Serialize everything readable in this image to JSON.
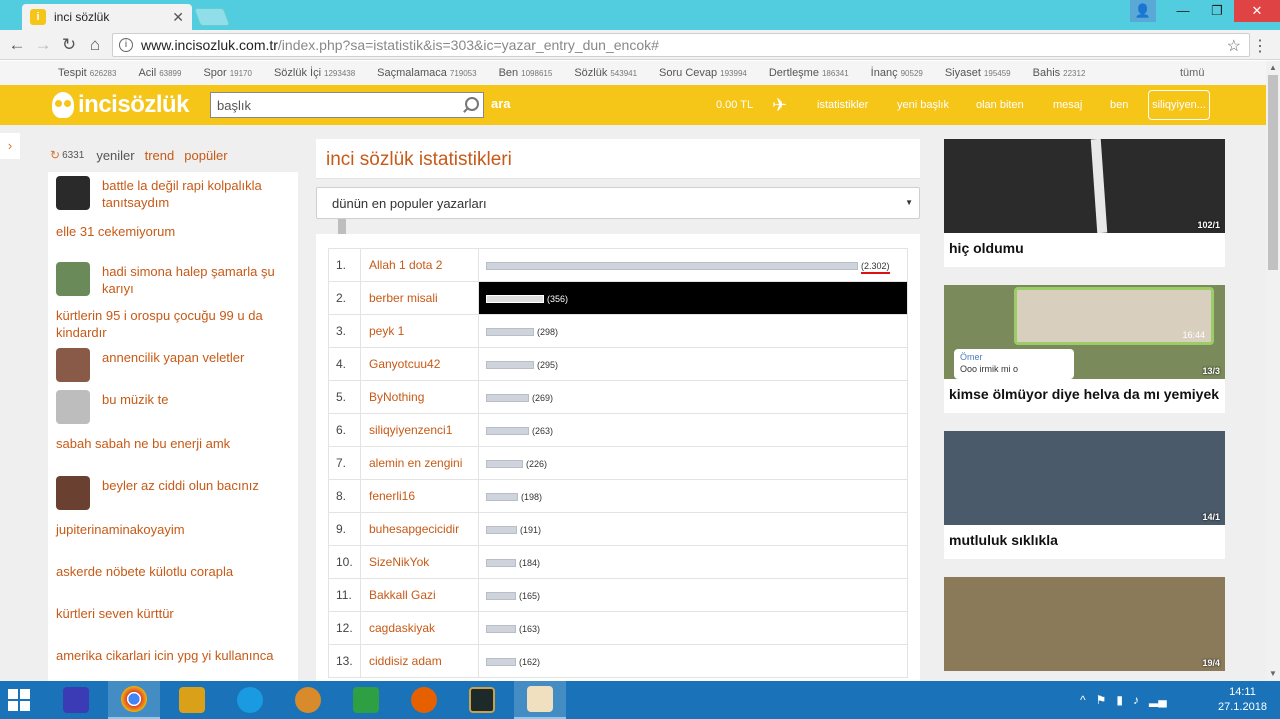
{
  "browser": {
    "tab_title": "inci sözlük",
    "url_host": "www.incisozluk.com.tr",
    "url_path": "/index.php?sa=istatistik&is=303&ic=yazar_entry_dun_encok#"
  },
  "categories": [
    {
      "name": "Tespit",
      "count": "626283"
    },
    {
      "name": "Acil",
      "count": "63899"
    },
    {
      "name": "Spor",
      "count": "19170"
    },
    {
      "name": "Sözlük İçi",
      "count": "1293438"
    },
    {
      "name": "Saçmalamaca",
      "count": "719053"
    },
    {
      "name": "Ben",
      "count": "1098615"
    },
    {
      "name": "Sözlük",
      "count": "543941"
    },
    {
      "name": "Soru Cevap",
      "count": "193994"
    },
    {
      "name": "Dertleşme",
      "count": "186341"
    },
    {
      "name": "İnanç",
      "count": "90529"
    },
    {
      "name": "Siyaset",
      "count": "195459"
    },
    {
      "name": "Bahis",
      "count": "22312"
    }
  ],
  "categories_all": "tümü",
  "header": {
    "logo": "incisözlük",
    "search_placeholder": "başlık",
    "search_button": "ara",
    "balance": "0.00 TL",
    "links": [
      "istatistikler",
      "yeni başlık",
      "olan biten",
      "mesaj",
      "ben"
    ],
    "user": "siliqyiyen..."
  },
  "left": {
    "refresh_count": "6331",
    "tabs": [
      "yeniler",
      "trend",
      "popüler"
    ],
    "items": [
      {
        "title": "battle la değil rapi kolpalıkla tanıtsaydım",
        "thumb": "#2a2a2a"
      },
      {
        "title": "elle 31 cekemiyorum",
        "thumb": null
      },
      {
        "title": "hadi simona halep şamarla şu karıyı",
        "thumb": "#6b8a5a"
      },
      {
        "title": "kürtlerin 95 i orospu çocuğu 99 u da kindardır",
        "thumb": null
      },
      {
        "title": "annencilik yapan veletler",
        "thumb": "#8a5a48"
      },
      {
        "title": "bu müzik te",
        "thumb": "#bdbdbd"
      },
      {
        "title": "sabah sabah ne bu enerji amk",
        "thumb": null
      },
      {
        "title": "beyler az ciddi olun bacınız",
        "thumb": "#6a4030"
      },
      {
        "title": "jupiterinaminakoyayim",
        "thumb": null
      },
      {
        "title": "askerde nöbete külotlu corapla",
        "thumb": null
      },
      {
        "title": "kürtleri seven kürttür",
        "thumb": null
      },
      {
        "title": "amerika cikarlari icin ypg yi kullanınca",
        "thumb": null
      }
    ]
  },
  "center": {
    "title": "inci sözlük istatistikleri",
    "select_value": "dünün en populer yazarları",
    "rows": [
      {
        "rank": "1.",
        "author": "Allah 1 dota 2",
        "count": "(2.302)"
      },
      {
        "rank": "2.",
        "author": "berber misali",
        "count": "(356)"
      },
      {
        "rank": "3.",
        "author": "peyk 1",
        "count": "(298)"
      },
      {
        "rank": "4.",
        "author": "Ganyotcuu42",
        "count": "(295)"
      },
      {
        "rank": "5.",
        "author": "ByNothing",
        "count": "(269)"
      },
      {
        "rank": "6.",
        "author": "siliqyiyenzenci1",
        "count": "(263)"
      },
      {
        "rank": "7.",
        "author": "alemin en zengini",
        "count": "(226)"
      },
      {
        "rank": "8.",
        "author": "fenerli16",
        "count": "(198)"
      },
      {
        "rank": "9.",
        "author": "buhesapgecicidir",
        "count": "(191)"
      },
      {
        "rank": "10.",
        "author": "SizeNikYok",
        "count": "(184)"
      },
      {
        "rank": "11.",
        "author": "Bakkall Gazi",
        "count": "(165)"
      },
      {
        "rank": "12.",
        "author": "cagdaskiyak",
        "count": "(163)"
      },
      {
        "rank": "13.",
        "author": "ciddisiz adam",
        "count": "(162)"
      }
    ],
    "values": [
      2302,
      356,
      298,
      295,
      269,
      263,
      226,
      198,
      191,
      184,
      165,
      163,
      162
    ]
  },
  "right": {
    "cards": [
      {
        "title": "hiç oldumu",
        "badge": "102/1",
        "bg": "#2b2b2b"
      },
      {
        "title": "kimse ölmüyor diye helva da mı yemiyek",
        "badge": "13/3",
        "bg": "#7a8a5a",
        "chat_name": "Ömer",
        "chat_msg": "Ooo irmik mi o",
        "chat_time": "16:44"
      },
      {
        "title": "mutluluk sıklıkla",
        "badge": "14/1",
        "bg": "#4a5a6a"
      },
      {
        "title": "",
        "badge": "19/4",
        "bg": "#8a7a5a"
      }
    ]
  },
  "taskbar": {
    "time": "14:11",
    "date": "27.1.2018"
  }
}
